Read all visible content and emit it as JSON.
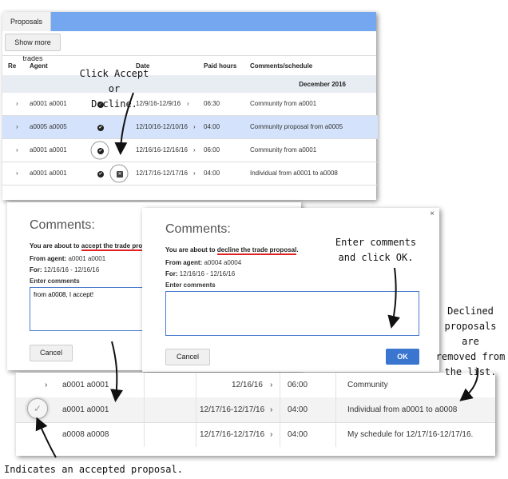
{
  "proposals": {
    "tab_label": "Proposals",
    "show_more_button": "Show more trades",
    "columns": [
      "Re",
      "Agent",
      "Date",
      "Paid hours",
      "Comments/schedule"
    ],
    "group_label": "December 2016",
    "rows": [
      {
        "agent": "a0001 a0001",
        "date": "12/9/16-12/9/16",
        "hours": "06:30",
        "comment": "Community from a0001"
      },
      {
        "agent": "a0005 a0005",
        "date": "12/10/16-12/10/16",
        "hours": "04:00",
        "comment": "Community proposal from a0005"
      },
      {
        "agent": "a0001 a0001",
        "date": "12/16/16-12/16/16",
        "hours": "06:00",
        "comment": "Community from a0001"
      },
      {
        "agent": "a0001 a0001",
        "date": "12/17/16-12/17/16",
        "hours": "04:00",
        "comment": "Individual from a0001 to a0008"
      }
    ]
  },
  "accept_dialog": {
    "title": "Comments:",
    "message_prefix": "You are about to ",
    "message_highlight": "accept the trade proposa",
    "from_label": "From agent:",
    "from_value": "a0001 a0001",
    "for_label": "For:",
    "for_value": "12/16/16 - 12/16/16",
    "enter_label": "Enter comments",
    "comment_value": "from a0008, I accept!",
    "cancel_label": "Cancel"
  },
  "decline_dialog": {
    "title": "Comments:",
    "close_glyph": "×",
    "message_prefix": "You are about to ",
    "message_highlight": "decline the trade proposal",
    "message_suffix": ".",
    "from_label": "From agent:",
    "from_value": "a0004 a0004",
    "for_label": "For:",
    "for_value": "12/16/16 - 12/16/16",
    "enter_label": "Enter comments",
    "comment_value": "",
    "cancel_label": "Cancel",
    "ok_label": "OK"
  },
  "result_table": {
    "rows": [
      {
        "agent": "a0001 a0001",
        "date": "12/16/16",
        "hours": "06:00",
        "comment": "Community"
      },
      {
        "agent": "a0001 a0001",
        "date": "12/17/16-12/17/16",
        "hours": "04:00",
        "comment": "Individual from a0001 to a0008"
      },
      {
        "agent": "a0008 a0008",
        "date": "12/17/16-12/17/16",
        "hours": "04:00",
        "comment": "My schedule for 12/17/16-12/17/16."
      }
    ]
  },
  "annotations": {
    "click_line1": "Click Accept or",
    "click_line2": "Decline.",
    "enter_line1": "Enter comments",
    "enter_line2": "and click OK.",
    "declined_line1": "Declined",
    "declined_line2": "proposals are",
    "declined_line3": "removed from",
    "declined_line4": "the list.",
    "indicates": "Indicates an accepted proposal."
  },
  "colors": {
    "header_blue": "#74a7f0",
    "selected_row": "#d4e3fb",
    "group_bg": "#e8edf4",
    "ok_button": "#3a76d0",
    "underline_red": "#e02020"
  },
  "icons": [
    "expand-chevron-icon",
    "accept-check-icon",
    "decline-x-icon",
    "close-icon",
    "accepted-indicator-icon"
  ]
}
